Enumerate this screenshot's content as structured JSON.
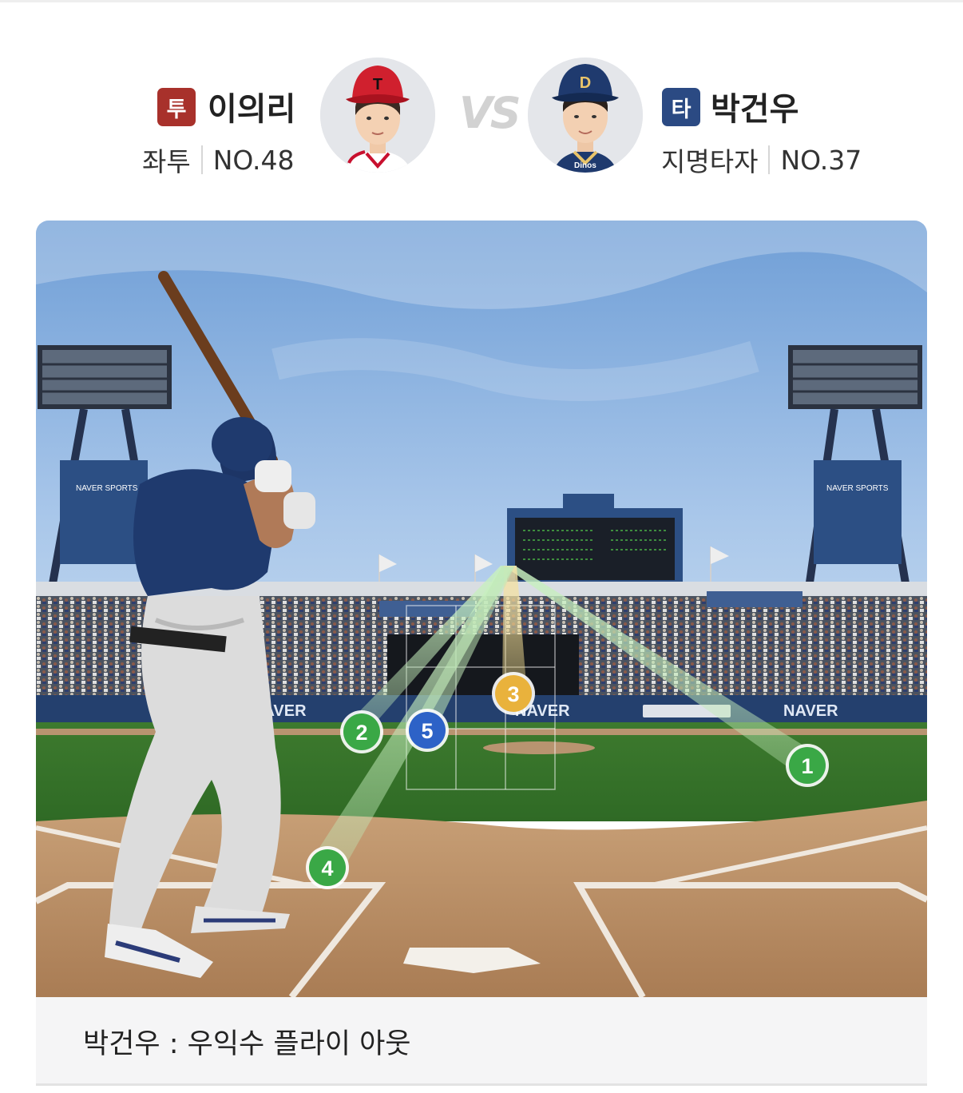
{
  "pitcher": {
    "role_badge": "투",
    "name": "이의리",
    "throw_hand": "좌투",
    "number": "NO.48",
    "team_color": "#a8312b"
  },
  "vs_label": "VS",
  "batter": {
    "role_badge": "타",
    "name": "박건우",
    "position": "지명타자",
    "number": "NO.37",
    "team_color": "#2b4a83"
  },
  "field": {
    "ad_text": "NAVER",
    "pitches": [
      {
        "number": "1",
        "color": "#3aa846"
      },
      {
        "number": "2",
        "color": "#3aa846"
      },
      {
        "number": "3",
        "color": "#e9b23c"
      },
      {
        "number": "4",
        "color": "#3aa846"
      },
      {
        "number": "5",
        "color": "#2d62c7"
      }
    ]
  },
  "result": {
    "text": "박건우 : 우익수 플라이 아웃"
  }
}
